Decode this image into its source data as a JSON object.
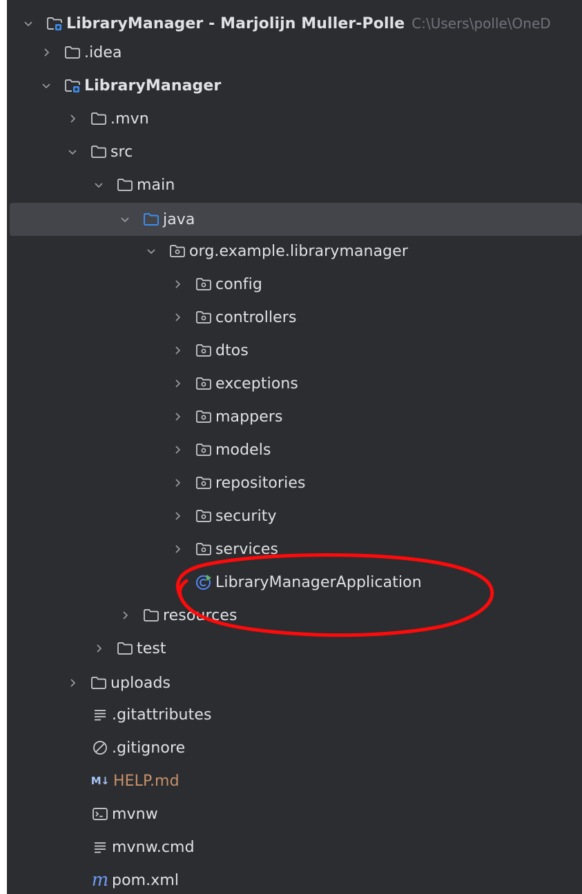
{
  "project": {
    "name": "LibraryManager - Marjolijn Muller-Polle",
    "path": "C:\\Users\\polle\\OneD"
  },
  "tree": [
    {
      "label": ".idea"
    },
    {
      "label": "LibraryManager"
    },
    {
      "label": ".mvn"
    },
    {
      "label": "src"
    },
    {
      "label": "main"
    },
    {
      "label": "java"
    },
    {
      "label": "org.example.librarymanager"
    },
    {
      "label": "config"
    },
    {
      "label": "controllers"
    },
    {
      "label": "dtos"
    },
    {
      "label": "exceptions"
    },
    {
      "label": "mappers"
    },
    {
      "label": "models"
    },
    {
      "label": "repositories"
    },
    {
      "label": "security"
    },
    {
      "label": "services"
    },
    {
      "label": "LibraryManagerApplication"
    },
    {
      "label": "resources"
    },
    {
      "label": "test"
    },
    {
      "label": "uploads"
    },
    {
      "label": ".gitattributes"
    },
    {
      "label": ".gitignore"
    },
    {
      "label": "HELP.md"
    },
    {
      "label": "mvnw"
    },
    {
      "label": "mvnw.cmd"
    },
    {
      "label": "pom.xml"
    }
  ],
  "icons": {
    "markdown_glyph": "M↓",
    "maven_glyph": "m"
  },
  "colors": {
    "background": "#2b2d30",
    "selection": "#43454a",
    "text": "#dfe1e5",
    "folder_blue": "#3d8ef0",
    "annotation_red": "#ff0000",
    "markdown_text": "#c8916b"
  }
}
